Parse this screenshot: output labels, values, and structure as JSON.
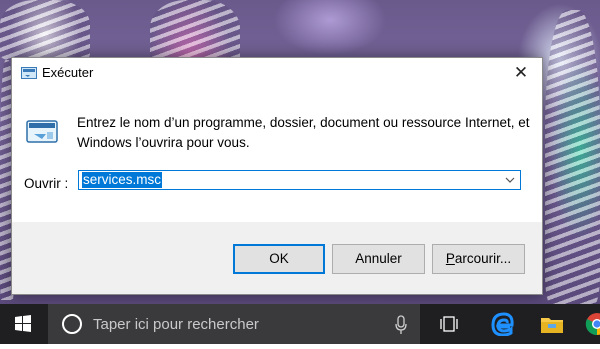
{
  "dialog": {
    "title": "Exécuter",
    "close_glyph": "✕",
    "description": "Entrez le nom d’un programme, dossier, document ou ressource Internet, et Windows l’ouvrira pour vous.",
    "open_label": "Ouvrir :",
    "open_value": "services.msc",
    "buttons": {
      "ok": "OK",
      "cancel": "Annuler",
      "browse_accel": "P",
      "browse_rest": "arcourir..."
    }
  },
  "taskbar": {
    "search_placeholder": "Taper ici pour rechercher",
    "icons": [
      "windows-start-icon",
      "cortana-icon",
      "microphone-icon",
      "task-view-icon",
      "edge-icon",
      "file-explorer-icon",
      "chrome-icon"
    ]
  },
  "colors": {
    "accent": "#0078d7",
    "taskbar": "#1f1f22",
    "search_box": "#3a3a3d",
    "dialog_footer": "#f0f0f0"
  }
}
